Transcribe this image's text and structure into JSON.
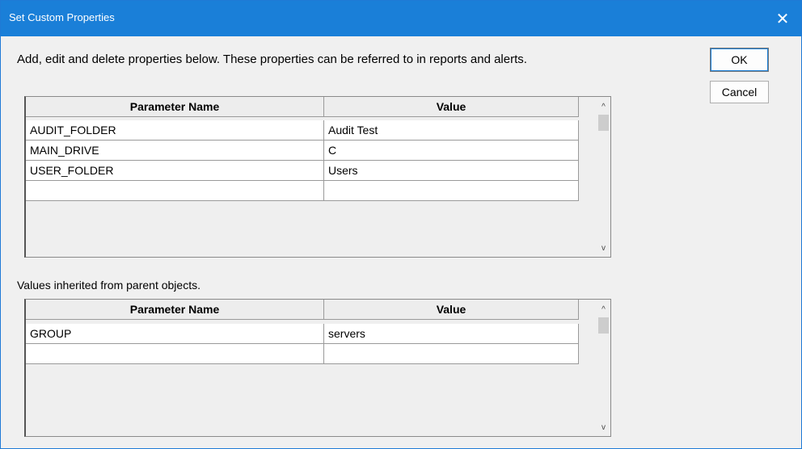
{
  "window": {
    "title": "Set Custom Properties",
    "close_glyph": "✕"
  },
  "instructions": "Add, edit and delete properties below.  These properties can be referred to in reports and alerts.",
  "buttons": {
    "ok": "OK",
    "cancel": "Cancel"
  },
  "custom_grid": {
    "headers": [
      "Parameter Name",
      "Value"
    ],
    "rows": [
      [
        "AUDIT_FOLDER",
        "Audit Test"
      ],
      [
        "MAIN_DRIVE",
        "C"
      ],
      [
        "USER_FOLDER",
        "Users"
      ],
      [
        "",
        ""
      ]
    ]
  },
  "inherited_label": "Values inherited from parent objects.",
  "inherited_grid": {
    "headers": [
      "Parameter Name",
      "Value"
    ],
    "rows": [
      [
        "GROUP",
        "servers"
      ],
      [
        "",
        ""
      ]
    ]
  },
  "scroll_arrows": {
    "up": "^",
    "down": "v"
  },
  "colors": {
    "titlebar": "#1a7fd8",
    "dialog_bg": "#f0f0f0"
  }
}
